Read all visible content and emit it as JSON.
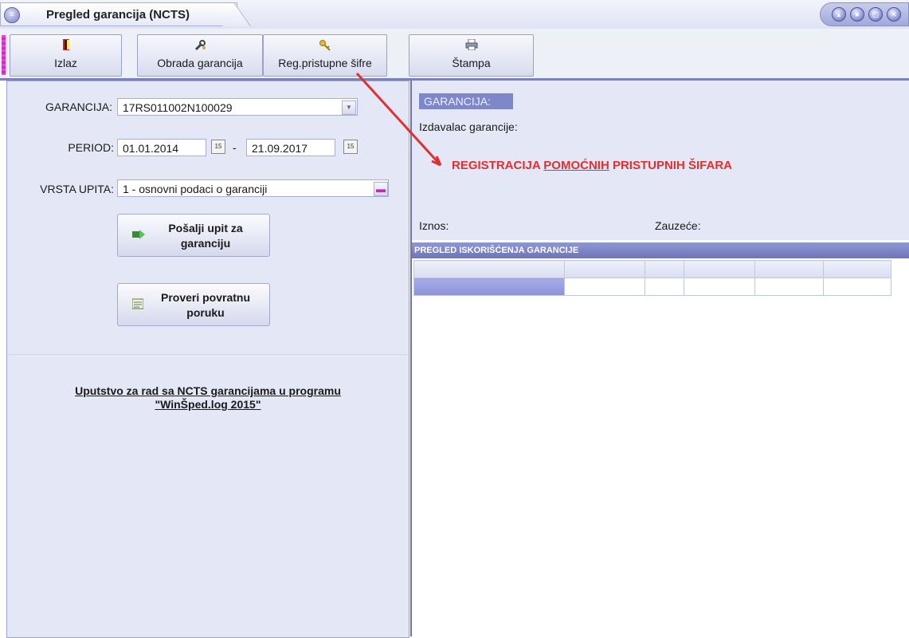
{
  "window": {
    "title": "Pregled garancija (NCTS)"
  },
  "toolbar": {
    "exit_label": "Izlaz",
    "process_label": "Obrada garancija",
    "reg_label": "Reg.pristupne šifre",
    "print_label": "Štampa"
  },
  "form": {
    "garancija_label": "GARANCIJA:",
    "garancija_value": "17RS011002N100029",
    "period_label": "PERIOD:",
    "period_from": "01.01.2014",
    "period_separator": "-",
    "period_to": "21.09.2017",
    "calendar_glyph": "15",
    "vrsta_label": "VRSTA UPITA:",
    "vrsta_value": "1 - osnovni podaci o garanciji",
    "send_button_line1": "Pošalji upit za",
    "send_button_line2": "garanciju",
    "check_button_line1": "Proveri povratnu",
    "check_button_line2": "poruku",
    "help_line1": "Uputstvo za rad sa NCTS garancijama u programu",
    "help_line2": "\"WinŠped.log 2015\""
  },
  "details": {
    "section_badge": "GARANCIJA:",
    "issuer_label": "Izdavalac garancije:",
    "amount_label": "Iznos:",
    "occupied_label": "Zauzeće:"
  },
  "grid": {
    "title": "PREGLED ISKORIŠĆENJA GARANCIJE",
    "column_count": 6,
    "row_count": 1
  },
  "annotation": {
    "text_before": "REGISTRACIJA ",
    "text_underlined": "POMOĆNIH",
    "text_after": " PRISTUPNIH ŠIFARA",
    "color": "#e03030"
  },
  "colors": {
    "panel_background": "#e4e7f5",
    "accent": "#7e87c8",
    "grid_header": "#6d75bb",
    "annotation": "#e03030"
  }
}
